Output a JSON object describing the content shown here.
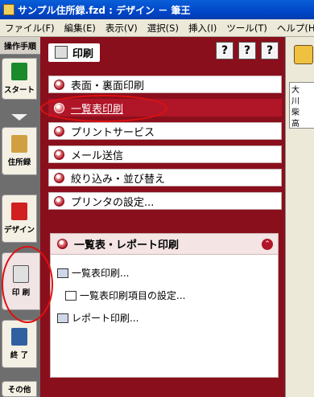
{
  "window": {
    "title": "サンプル住所録.fzd : デザイン － 筆王"
  },
  "menubar": [
    "ファイル(F)",
    "編集(E)",
    "表示(V)",
    "選択(S)",
    "挿入(I)",
    "ツール(T)",
    "ヘルプ(H)"
  ],
  "leftbar": {
    "header": "操作手順",
    "tabs": [
      "スタート",
      "住所録",
      "デザイン",
      "印 刷",
      "終 了",
      "その他"
    ]
  },
  "panel": {
    "title": "印刷",
    "head_buttons": [
      "?",
      "?",
      "?"
    ],
    "items": [
      "表面・裏面印刷",
      "一覧表印刷",
      "プリントサービス",
      "メール送信",
      "絞り込み・並び替え",
      "プリンタの設定..."
    ]
  },
  "subpanel": {
    "title": "一覧表・レポート印刷",
    "items": [
      "一覧表印刷...",
      "一覧表印刷項目の設定...",
      "レポート印刷..."
    ]
  },
  "right": {
    "rows": [
      "大",
      "川",
      "柴",
      "高"
    ]
  }
}
